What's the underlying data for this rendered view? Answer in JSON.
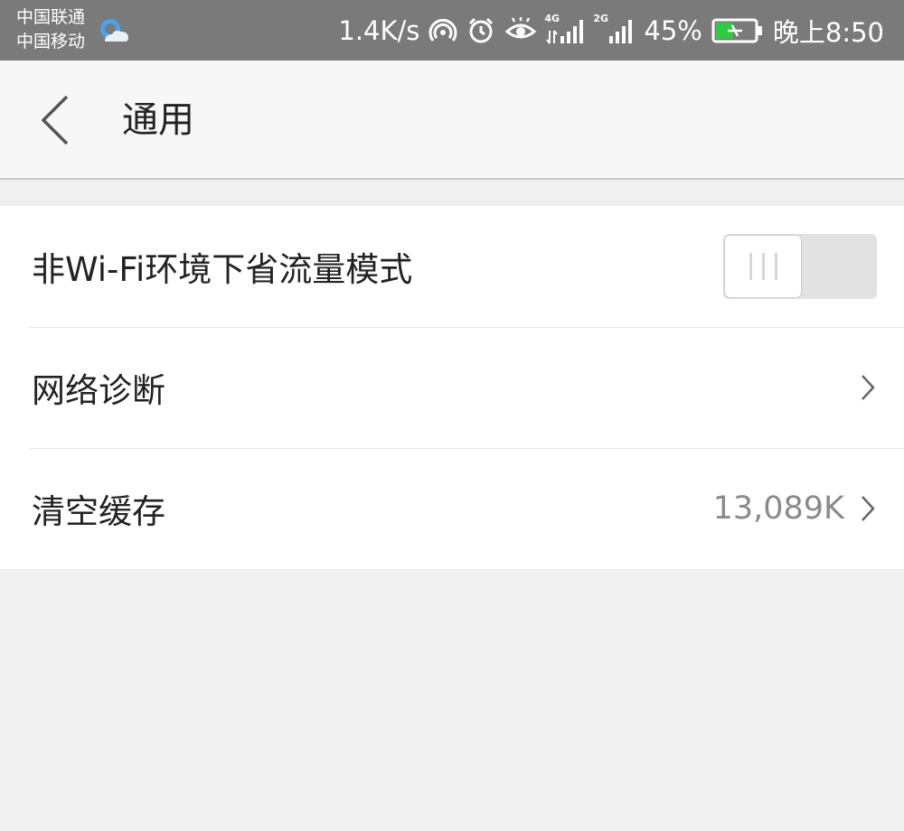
{
  "status_bar": {
    "carrier_1": "中国联通",
    "carrier_2": "中国移动",
    "speed": "1.4K/s",
    "net_1": "4G",
    "net_2": "2G",
    "battery_percent": "45%",
    "battery_level": 45,
    "time": "晚上8:50",
    "icons": [
      "weather-icon",
      "hotspot-icon",
      "alarm-icon",
      "eye-care-icon",
      "signal-4g-icon",
      "signal-2g-icon",
      "battery-charging-icon"
    ]
  },
  "header": {
    "title": "通用",
    "back_icon": "chevron-left-icon"
  },
  "settings": {
    "items": [
      {
        "label": "非Wi-Fi环境下省流量模式",
        "control": "toggle",
        "toggle_on": false
      },
      {
        "label": "网络诊断",
        "control": "chevron"
      },
      {
        "label": "清空缓存",
        "value": "13,089K",
        "control": "chevron"
      }
    ]
  },
  "colors": {
    "status_bar_bg": "#7a7a7a",
    "title_bar_bg": "#f7f7f7",
    "page_bg": "#f0f0f0",
    "battery_green": "#2ecc40",
    "toggle_off_bg": "#e2e2e2"
  }
}
